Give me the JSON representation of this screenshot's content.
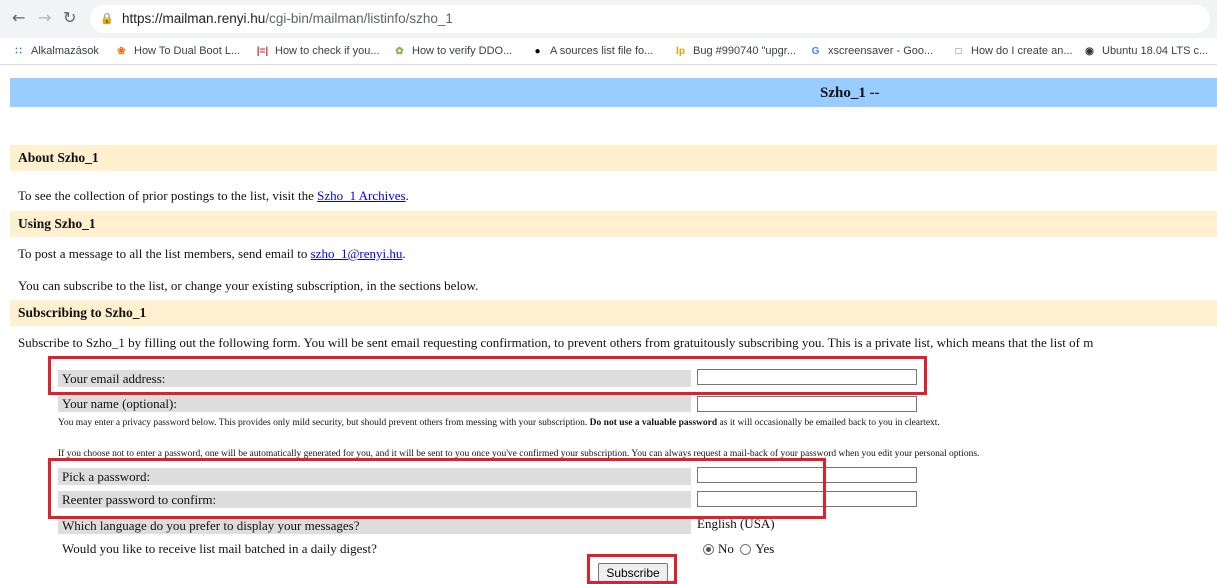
{
  "browser": {
    "url_host": "https://mailman.renyi.hu",
    "url_path": "/cgi-bin/mailman/listinfo/szho_1",
    "bookmarks": [
      {
        "icon": "apps-grid-icon",
        "label": "Alkalmazások"
      },
      {
        "icon": "flower-icon",
        "label": "How To Dual Boot L..."
      },
      {
        "icon": "bars-icon",
        "label": "How to check if you..."
      },
      {
        "icon": "leaf-icon",
        "label": "How to verify DDO..."
      },
      {
        "icon": "github-icon",
        "label": "A sources list file fo..."
      },
      {
        "icon": "launchpad-icon",
        "label": "Bug #990740 \"upgr..."
      },
      {
        "icon": "google-icon",
        "label": "xscreensaver - Goo..."
      },
      {
        "icon": "document-icon",
        "label": "How do I create an..."
      },
      {
        "icon": "ubuntu-icon",
        "label": "Ubuntu 18.04 LTS c..."
      }
    ]
  },
  "page": {
    "title": "Szho_1 --",
    "about": {
      "heading": "About Szho_1",
      "text_before": "To see the collection of prior postings to the list, visit the ",
      "link": "Szho_1 Archives",
      "text_after": "."
    },
    "using": {
      "heading": "Using Szho_1",
      "text_before": "To post a message to all the list members, send email to ",
      "link": "szho_1@renyi.hu",
      "text_after": ".",
      "text2": "You can subscribe to the list, or change your existing subscription, in the sections below."
    },
    "subscribing": {
      "heading": "Subscribing to Szho_1",
      "intro": "Subscribe to Szho_1 by filling out the following form. You will be sent email requesting confirmation, to prevent others from gratuitously subscribing you. This is a private list, which means that the list of m",
      "email_label": "Your email address:",
      "name_label": "Your name (optional):",
      "privacy_before": "You may enter a privacy password below. This provides only mild security, but should prevent others from messing with your subscription. ",
      "privacy_bold": "Do not use a valuable password",
      "privacy_after": " as it will occasionally be emailed back to you in cleartext.",
      "auto_password_note": "If you choose not to enter a password, one will be automatically generated for you, and it will be sent to you once you've confirmed your subscription. You can always request a mail-back of your password when you edit your personal options.",
      "password_label": "Pick a password:",
      "confirm_label": "Reenter password to confirm:",
      "language_label": "Which language do you prefer to display your messages?",
      "language_value": "English (USA)",
      "digest_label": "Would you like to receive list mail batched in a daily digest?",
      "digest_no": "No",
      "digest_yes": "Yes",
      "digest_selected": "No",
      "subscribe_button": "Subscribe"
    }
  },
  "colors": {
    "title_bar": "#99ccff",
    "section_bar": "#fff0d0",
    "field_label": "#dddddd",
    "annotation": "#e0202a"
  }
}
